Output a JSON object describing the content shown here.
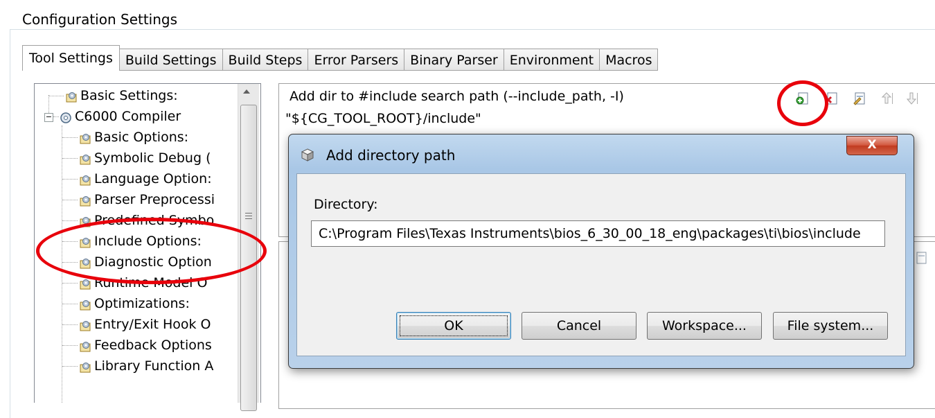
{
  "group": {
    "title": "Configuration Settings"
  },
  "tabs": [
    {
      "label": "Tool Settings",
      "active": true
    },
    {
      "label": "Build Settings"
    },
    {
      "label": "Build Steps"
    },
    {
      "label": "Error Parsers"
    },
    {
      "label": "Binary Parser"
    },
    {
      "label": "Environment"
    },
    {
      "label": "Macros"
    }
  ],
  "tree": {
    "items": [
      {
        "label": "Basic Settings:"
      },
      {
        "label": "C6000 Compiler"
      },
      {
        "label": "Basic Options:"
      },
      {
        "label": "Symbolic Debug ("
      },
      {
        "label": "Language Option:"
      },
      {
        "label": "Parser Preprocessi"
      },
      {
        "label": "Predefined Symbo"
      },
      {
        "label": "Include Options:"
      },
      {
        "label": "Diagnostic Option"
      },
      {
        "label": "Runtime Model O"
      },
      {
        "label": "Optimizations:"
      },
      {
        "label": "Entry/Exit Hook O"
      },
      {
        "label": "Feedback Options"
      },
      {
        "label": "Library Function A"
      }
    ],
    "expander_symbol": "−"
  },
  "include_panel": {
    "title": "Add dir to #include search path (--include_path, -I)",
    "paths": [
      "\"${CG_TOOL_ROOT}/include\""
    ]
  },
  "toolbar_icons": [
    "add-icon",
    "delete-icon",
    "edit-icon",
    "move-up-icon",
    "move-down-icon"
  ],
  "dialog": {
    "title": "Add directory path",
    "close_symbol": "X",
    "directory_label": "Directory:",
    "directory_value": "C:\\Program Files\\Texas Instruments\\bios_6_30_00_18_eng\\packages\\ti\\bios\\include",
    "buttons": {
      "ok": "OK",
      "cancel": "Cancel",
      "workspace": "Workspace...",
      "file_system": "File system..."
    }
  },
  "annotation_color": "#e8000b"
}
